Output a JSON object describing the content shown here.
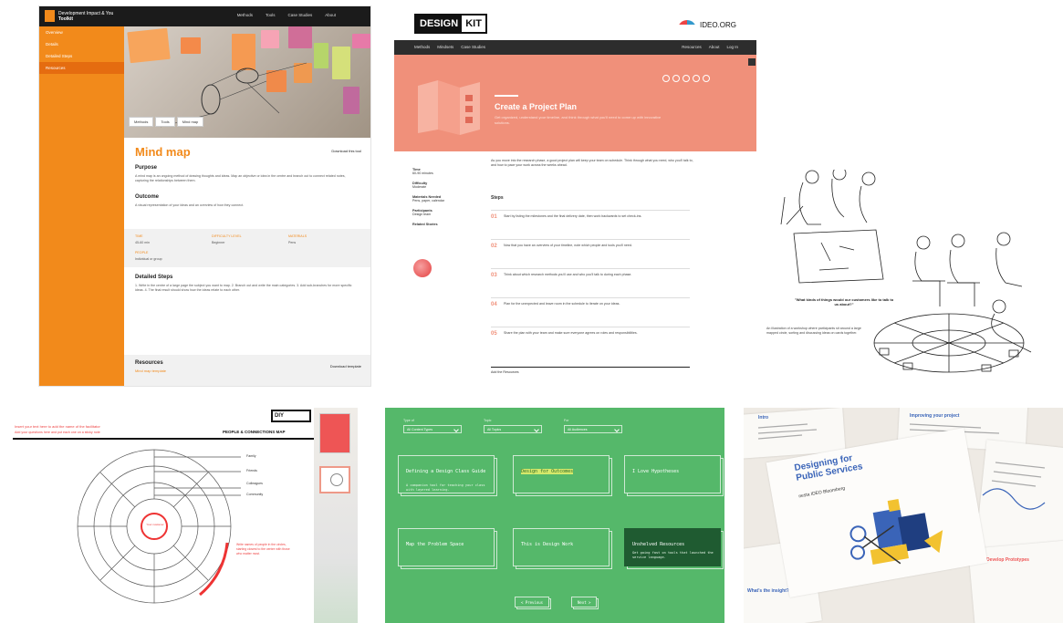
{
  "mindmap": {
    "brand_line1": "Development Impact & You",
    "brand_line2": "Toolkit",
    "nav": [
      "Methods",
      "Tools",
      "Case Studies",
      "About"
    ],
    "sidebar": [
      "Overview",
      "Details",
      "Detailed Steps",
      "Resources"
    ],
    "breadcrumbs": [
      "Methods",
      "Tools",
      "Mind map"
    ],
    "title": "Mind map",
    "download": "Download this tool",
    "purpose_heading": "Purpose",
    "purpose_text": "A mind map is an ongoing method of drawing thoughts and ideas. Map an objective or idea in the centre and branch out to connect related notes, capturing the relationships between them.",
    "outcome_heading": "Outcome",
    "outcome_text": "A visual representation of your ideas and an overview of how they connect.",
    "meta": [
      {
        "label": "TIME",
        "value": "45-60 min"
      },
      {
        "label": "DIFFICULTY LEVEL",
        "value": "Beginner"
      },
      {
        "label": "MATERIALS",
        "value": "Pens"
      },
      {
        "label": "PEOPLE",
        "value": "Individual or group"
      }
    ],
    "steps_heading": "Detailed Steps",
    "steps_text": "1. Write in the centre of a large page the subject you want to map. 2. Branch out and write the main categories. 3. Add sub-branches for more specific ideas. 4. The final result should show how the ideas relate to each other.",
    "resources_heading": "Resources",
    "resources_link": "Mind map template",
    "resources_right": "Download template"
  },
  "designkit": {
    "brand_a": "DESIGN",
    "brand_b": "KIT",
    "org": "IDEO.ORG",
    "nav_left": [
      "Methods",
      "Mindsets",
      "Case Studies"
    ],
    "nav_right": [
      "Resources",
      "About",
      "Log In"
    ],
    "title": "Create a Project Plan",
    "subtitle": "Get organized, understand your timeline, and think through what you'll need to come up with innovative solutions.",
    "meta": [
      {
        "label": "Time",
        "value": "60-90 minutes"
      },
      {
        "label": "Difficulty",
        "value": "Moderate"
      },
      {
        "label": "Materials Needed",
        "value": "Pens, paper, calendar"
      },
      {
        "label": "Participants",
        "value": "Design team"
      }
    ],
    "related_label": "Related Stories",
    "intro": "As you move into the research phase, a good project plan will keep your team on schedule. Think through what you need, who you'll talk to, and how to pace your work across the weeks ahead.",
    "steps_heading": "Steps",
    "steps": [
      {
        "num": "01",
        "text": "Start by listing the milestones and the final delivery date, then work backwards to set check-ins."
      },
      {
        "num": "02",
        "text": "Now that you have an overview of your timeline, note which people and tools you'll need."
      },
      {
        "num": "03",
        "text": "Think about which research methods you'll use and who you'll talk to during each phase."
      },
      {
        "num": "04",
        "text": "Plan for the unexpected and leave room in the schedule to iterate on your ideas."
      },
      {
        "num": "05",
        "text": "Share the plan with your team and make sure everyone agrees on roles and responsibilities."
      }
    ],
    "footer": "Add the Resources"
  },
  "sketch": {
    "caption": "\"What kinds of things would our customers like to talk to us about?\"",
    "body": "An illustration of a workshop where participants sit around a large mapped circle, sorting and discussing ideas on cards together."
  },
  "diagram": {
    "heading": "Insert your text here to add the name of the facilitator",
    "subheading": "Add your questions here and put each one on a sticky note",
    "title": "PEOPLE & CONNECTIONS MAP",
    "logo": "DIY",
    "ring_labels": [
      "Family",
      "Friends",
      "Colleagues",
      "Community"
    ],
    "center_label": "Your customer",
    "note": "Write names of people in the circles, starting closest to the centre with those who matter most."
  },
  "cards": {
    "filters": [
      {
        "label": "Type of",
        "value": "All Content Types"
      },
      {
        "label": "Topic",
        "value": "All Topics"
      },
      {
        "label": "For",
        "value": "All Audiences"
      }
    ],
    "items": [
      {
        "title": "Defining a Design Class Guide",
        "sub": "A companion tool for teaching your class with layered learning.",
        "style": "normal"
      },
      {
        "title": "Design for Outcomes",
        "sub": "",
        "style": "hl"
      },
      {
        "title": "I Love Hypotheses",
        "sub": "",
        "style": "normal"
      },
      {
        "title": "Map the Problem Space",
        "sub": "",
        "style": "normal"
      },
      {
        "title": "This is Design Work",
        "sub": "",
        "style": "normal"
      },
      {
        "title": "Unshelved Resources",
        "sub": "Get going fast on tools that launched the service language.",
        "style": "dark"
      }
    ],
    "prev": "< Previous",
    "next": "Next >"
  },
  "publicservices": {
    "title": "Designing for Public Services",
    "logos": "nesta  IDEO  Bloomberg",
    "sheet_headers": [
      "Improving your project",
      "Intro",
      "What's the insight?",
      "Develop Prototypes"
    ]
  }
}
